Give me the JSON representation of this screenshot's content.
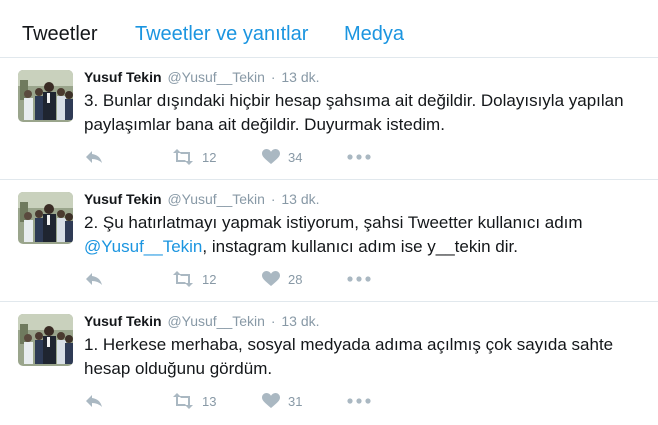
{
  "tabs": [
    {
      "label": "Tweetler"
    },
    {
      "label": "Tweetler ve yanıtlar"
    },
    {
      "label": "Medya"
    }
  ],
  "tweets": [
    {
      "fullname": "Yusuf Tekin",
      "username": "@Yusuf__Tekin",
      "separator": "·",
      "time": "13 dk.",
      "text_before": "3. Bunlar dışındaki hiçbir hesap şahsıma ait değildir. Dolayısıyla yapılan paylaşımlar bana ait değildir. Duyurmak istedim.",
      "mention": "",
      "text_after": "",
      "retweets": "12",
      "likes": "34"
    },
    {
      "fullname": "Yusuf Tekin",
      "username": "@Yusuf__Tekin",
      "separator": "·",
      "time": "13 dk.",
      "text_before": "2. Şu hatırlatmayı yapmak istiyorum, şahsi Tweetter kullanıcı adım ",
      "mention": "@Yusuf__Tekin",
      "text_after": ", instagram kullanıcı adım ise y__tekin dir.",
      "retweets": "12",
      "likes": "28"
    },
    {
      "fullname": "Yusuf Tekin",
      "username": "@Yusuf__Tekin",
      "separator": "·",
      "time": "13 dk.",
      "text_before": "1. Herkese merhaba, sosyal medyada adıma açılmış çok sayıda sahte hesap olduğunu gördüm.",
      "mention": "",
      "text_after": "",
      "retweets": "13",
      "likes": "31"
    }
  ],
  "icons": {
    "reply": "reply-icon",
    "retweet": "retweet-icon",
    "like": "heart-icon",
    "more": "more-dots-icon",
    "avatar": "avatar-photo"
  },
  "colors": {
    "link": "#1b95e0",
    "muted": "#8899a6",
    "icon": "#aab8c2",
    "divider": "#e1e8ed"
  }
}
